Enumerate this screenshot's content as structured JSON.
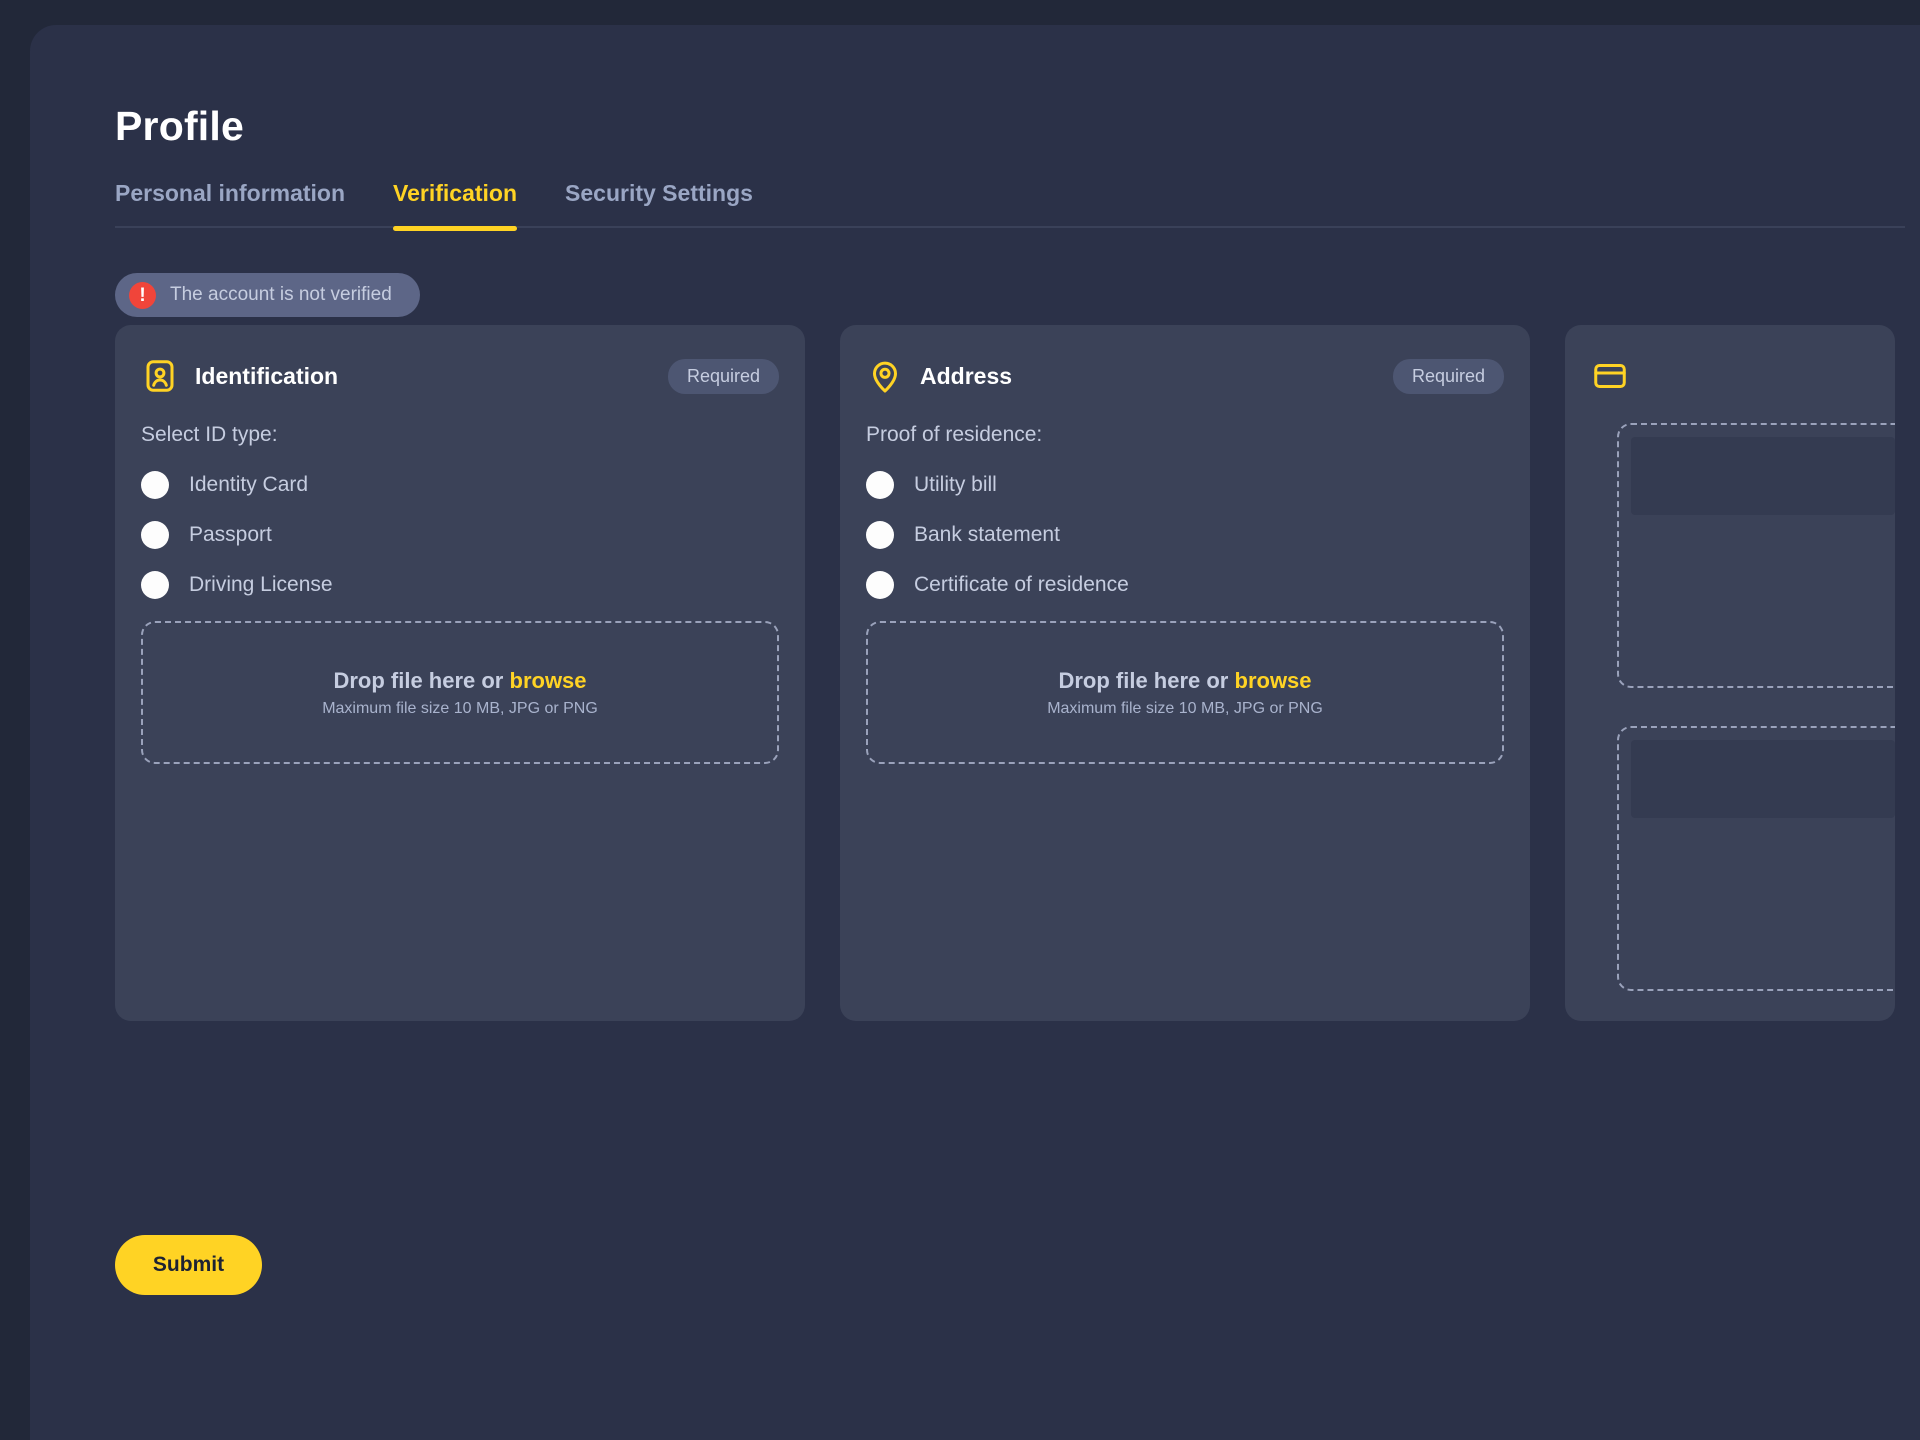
{
  "page": {
    "title": "Profile"
  },
  "tabs": [
    {
      "label": "Personal information",
      "active": false
    },
    {
      "label": "Verification",
      "active": true
    },
    {
      "label": "Security Settings",
      "active": false
    }
  ],
  "alert": {
    "icon": "exclamation-circle-icon",
    "text": "The account is not verified",
    "color": "#f0453a"
  },
  "cards": [
    {
      "id": "identification",
      "icon": "id-card-person-icon",
      "title": "Identification",
      "badge": "Required",
      "field_label": "Select ID type:",
      "options": [
        {
          "label": "Identity Card",
          "selected": false
        },
        {
          "label": "Passport",
          "selected": false
        },
        {
          "label": "Driving License",
          "selected": false
        }
      ],
      "dropzone": {
        "prompt": "Drop file here or ",
        "action": "browse",
        "hint": "Maximum file size 10 MB, JPG or PNG"
      }
    },
    {
      "id": "address",
      "icon": "map-pin-icon",
      "title": "Address",
      "badge": "Required",
      "field_label": "Proof of residence:",
      "options": [
        {
          "label": "Utility bill",
          "selected": false
        },
        {
          "label": "Bank statement",
          "selected": false
        },
        {
          "label": "Certificate of residence",
          "selected": false
        }
      ],
      "dropzone": {
        "prompt": "Drop file here or ",
        "action": "browse",
        "hint": "Maximum file size 10 MB, JPG or PNG"
      }
    },
    {
      "id": "payment-method",
      "icon": "credit-card-icon",
      "title": "",
      "badge": "",
      "field_label": "",
      "options": [],
      "dropzone": null
    }
  ],
  "submit": {
    "label": "Submit"
  },
  "theme": {
    "accent": "#ffd324",
    "page_bg": "#222839",
    "panel_bg": "#2b3148",
    "card_bg": "#3b4258",
    "text_muted": "#c6cde0",
    "danger": "#f0453a"
  }
}
